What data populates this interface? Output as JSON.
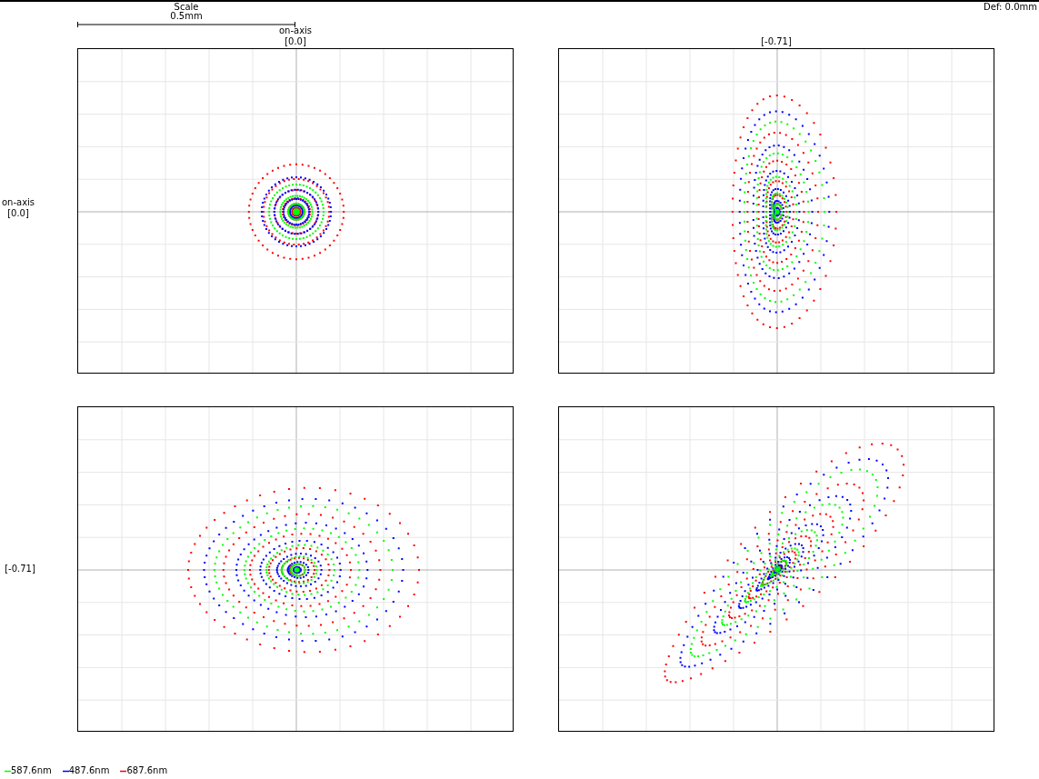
{
  "scale": {
    "title": "Scale",
    "value": "0.5mm"
  },
  "defocus": "Def: 0.0mm",
  "column_headers": [
    {
      "lines": [
        "on-axis",
        "[0.0]"
      ]
    },
    {
      "lines": [
        "[-0.71]"
      ]
    }
  ],
  "row_headers": [
    {
      "lines": [
        "on-axis",
        "[0.0]"
      ]
    },
    {
      "lines": [
        "[-0.71]"
      ]
    }
  ],
  "panels": [
    {
      "kind": "on-axis"
    },
    {
      "kind": "x-field"
    },
    {
      "kind": "y-field"
    },
    {
      "kind": "xy-field"
    }
  ],
  "legend": [
    {
      "label": "587.6nm",
      "color": "#00ff00"
    },
    {
      "label": "487.6nm",
      "color": "#0000ff"
    },
    {
      "label": "687.6nm",
      "color": "#ff0000"
    }
  ]
}
